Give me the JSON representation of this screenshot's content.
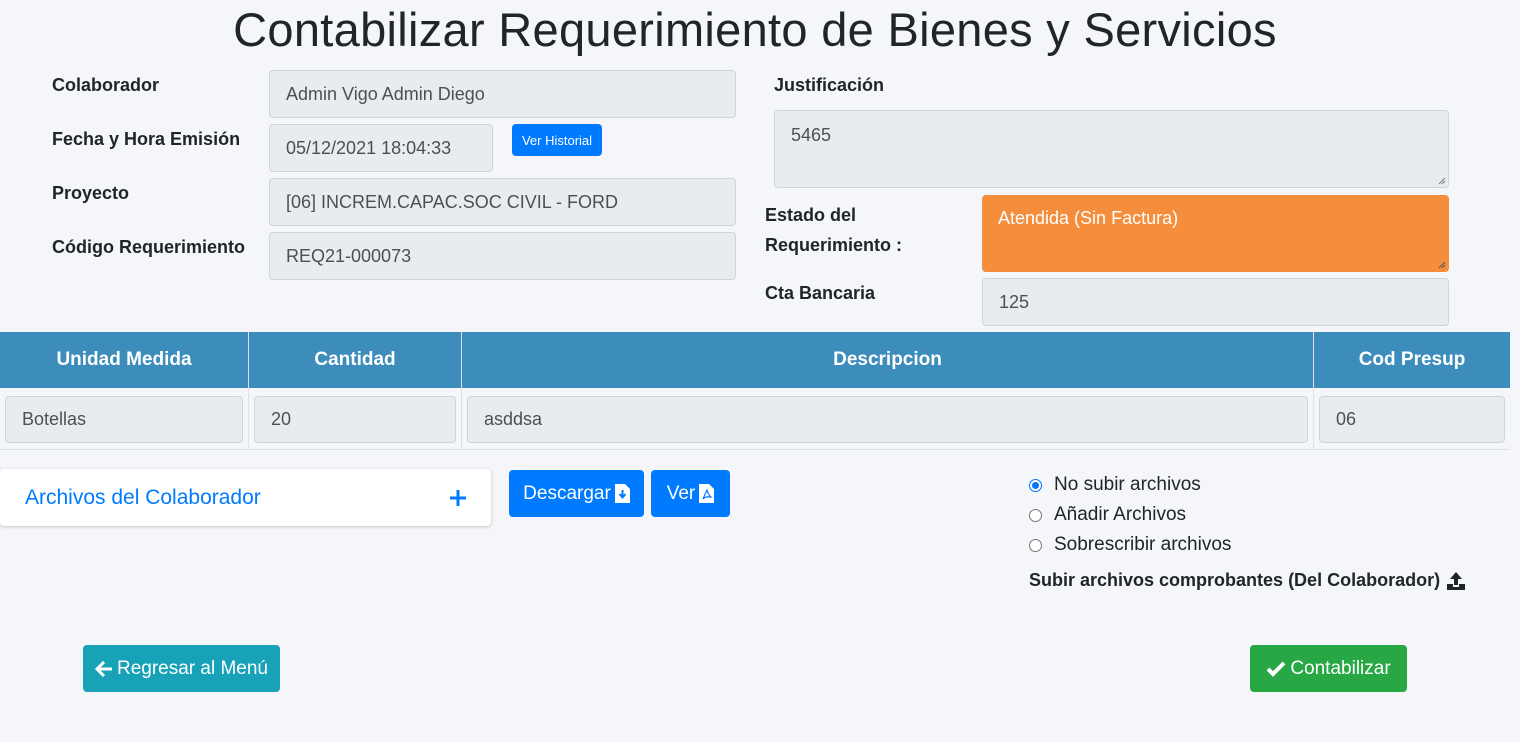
{
  "page": {
    "title": "Contabilizar Requerimiento de Bienes y Servicios"
  },
  "form": {
    "colaborador_label": "Colaborador",
    "colaborador_value": "Admin Vigo Admin Diego",
    "fecha_label": "Fecha y Hora Emisión",
    "fecha_value": "05/12/2021 18:04:33",
    "historial_button": "Ver Historial",
    "proyecto_label": "Proyecto",
    "proyecto_value": "[06] INCREM.CAPAC.SOC CIVIL - FORD",
    "codigo_label": "Código Requerimiento",
    "codigo_value": "REQ21-000073",
    "justificacion_label": "Justificación",
    "justificacion_value": "5465",
    "estado_label_line1": "Estado del",
    "estado_label_line2": "Requerimiento :",
    "estado_value": "Atendida (Sin Factura)",
    "estado_color": "#f48e3d",
    "cta_label": "Cta Bancaria",
    "cta_value": "125"
  },
  "table": {
    "headers": [
      "Unidad Medida",
      "Cantidad",
      "Descripcion",
      "Cod Presup"
    ],
    "header_color": "#3c8dbc",
    "rows": [
      [
        "Botellas",
        "20",
        "asddsa",
        "06"
      ]
    ]
  },
  "files": {
    "card_title": "Archivos del Colaborador",
    "download_button": "Descargar",
    "view_button": "Ver",
    "options": [
      "No subir archivos",
      "Añadir Archivos",
      "Sobrescribir archivos"
    ],
    "selected_option": "No subir archivos",
    "upload_label": "Subir archivos comprobantes (Del Colaborador)"
  },
  "actions": {
    "back_button": "Regresar al Menú",
    "submit_button": "Contabilizar",
    "back_color": "#17a2b8",
    "submit_color": "#28a745"
  },
  "icons": [
    "plus-icon",
    "file-download-icon",
    "file-pdf-icon",
    "upload-icon",
    "arrow-left-icon",
    "check-icon"
  ]
}
